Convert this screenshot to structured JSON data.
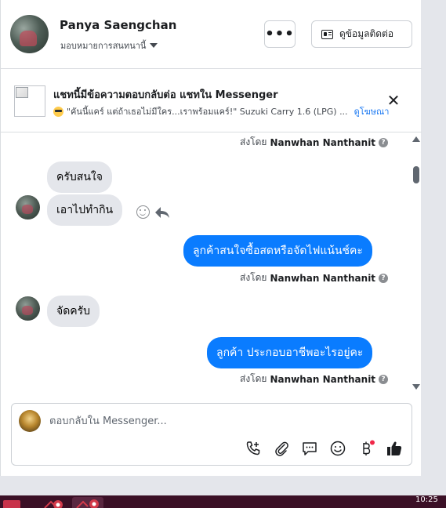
{
  "header": {
    "user_name": "Panya Saengchan",
    "assign_label": "มอบหมายการสนทนานี้",
    "more_label": "•••",
    "contact_label": "ดูข้อมูลติดต่อ"
  },
  "ad": {
    "title": "แชทนี้มีข้อความตอบกลับต่อ แชทใน Messenger",
    "subtitle": "\"คันนี้แคร์ แต่ถ้าเธอไม่มีใคร...เราพร้อมแคร์!\" Suzuki Carry 1.6 (LPG) ...",
    "link": "ดูโฆษณา",
    "close": "✕"
  },
  "messages": {
    "sent_by_label": "ส่งโดย",
    "agent_name": "Nanwhan Nanthanit",
    "help_glyph": "?",
    "in_1": "ครับสนใจ",
    "in_2": "เอาไปทำกิน",
    "out_1": "ลูกค้าสนใจซื้อสดหรือจัดไฟแน้นช์คะ",
    "in_3": "จัดครับ",
    "out_2": "ลูกค้า  ประกอบอาชีพอะไรอยู่คะ"
  },
  "composer": {
    "placeholder": "ตอบกลับใน Messenger..."
  },
  "taskbar": {
    "clock": "10:25"
  },
  "colors": {
    "outgoing_bubble": "#0a7cff",
    "incoming_bubble": "#e4e6eb",
    "link": "#1877f2",
    "like_icon": "#1c1e21",
    "notification_dot": "#f02849"
  },
  "icons": [
    "more-icon",
    "contact-card-icon",
    "close-icon",
    "help-icon",
    "react-icon",
    "reply-icon",
    "call-icon",
    "attach-icon",
    "saved-replies-icon",
    "emoji-icon",
    "payment-icon",
    "like-icon"
  ]
}
